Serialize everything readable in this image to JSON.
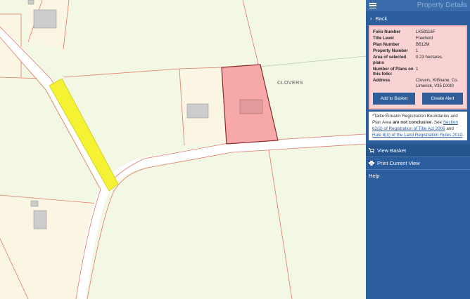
{
  "map": {
    "townland_label": "CLOVERS"
  },
  "sidebar": {
    "title": "Property Details",
    "menu_icon": "hamburger-menu-icon",
    "back_label": "Back",
    "details": {
      "folio_number_label": "Folio Number",
      "folio_number": "LK59116F",
      "title_level_label": "Title Level",
      "title_level": "Freehold",
      "plan_number_label": "Plan Number",
      "plan_number": "B612M",
      "property_number_label": "Property Number",
      "property_number": "1",
      "area_label": "Area of selected plans",
      "area": "0.23 hectares.",
      "num_plans_label": "Number of Plans on this folio:",
      "num_plans": "1",
      "address_label": "Address",
      "address": "Clovers, Kilfinane, Co. Limerick, V35 DX90"
    },
    "buttons": {
      "add_to_basket": "Add to Basket",
      "create_alert": "Create Alert"
    },
    "notice": {
      "part1": "*Tailte Éireann Registration Boundaries and Plan Area ",
      "bold": "are not conclusive",
      "part2": ". See ",
      "link1": "Section 62(2) of Registration of Title Act 2006",
      "part3": " and ",
      "link2": "Rule 8(3) of the Land Registration Rules 2012",
      "part4": "."
    },
    "menu": {
      "view_basket": "View Basket",
      "print_view": "Print Current View",
      "help": "Help"
    },
    "colors": {
      "panel": "#2c5d9c",
      "details_bg": "#f9d3d3",
      "selected_plot": "#f7a9a9",
      "road_highlight": "#f5f233"
    }
  }
}
